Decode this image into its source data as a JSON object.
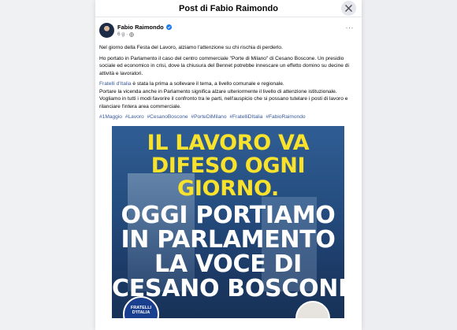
{
  "modal": {
    "title": "Post di Fabio Raimondo",
    "close_icon": "close-icon"
  },
  "post": {
    "author": "Fabio Raimondo",
    "time": "6 g",
    "more_label": "···",
    "paragraphs": {
      "p1": "Nel giorno della Festa del Lavoro, alziamo l'attenzione su chi rischia di perderlo.",
      "p2": "Ho portato in Parlamento il caso del centro commerciale \"Porte di Milano\" di Cesano Boscone. Un presidio sociale ed economico in crisi, dove la chiusura del Bennet potrebbe innescare un effetto domino su decine di attività e lavoratori.",
      "p3_link": "Fratelli d'Italia",
      "p3_rest": " è stata la prima a sollevare il tema, a livello comunale e regionale.",
      "p4": "Portare la vicenda anche in Parlamento significa alzare ulteriormente il livello di attenzione istituzionale.",
      "p5": "Vogliamo in tutti i modi favorire il confronto tra le parti, nell'auspicio che si possano tutelare i posti di lavoro e rilanciare l'intera area commerciale."
    },
    "hashtags": [
      "#1Maggio",
      "#Lavoro",
      "#CesanoBoscone",
      "#PorteDiMilano",
      "#FratelliDItalia",
      "#FabioRaimondo"
    ]
  },
  "poster": {
    "line1": "IL LAVORO VA",
    "line2": "DIFESO OGNI",
    "line3": "GIORNO.",
    "line4": "OGGI PORTIAMO",
    "line5": "IN PARLAMENTO",
    "line6": "LA VOCE DI",
    "line7": "CESANO BOSCONE",
    "badge": "FRATELLI D'ITALIA",
    "colors": {
      "yellow": "#f9e22b",
      "white": "#ffffff",
      "background": "#244c7e"
    }
  }
}
